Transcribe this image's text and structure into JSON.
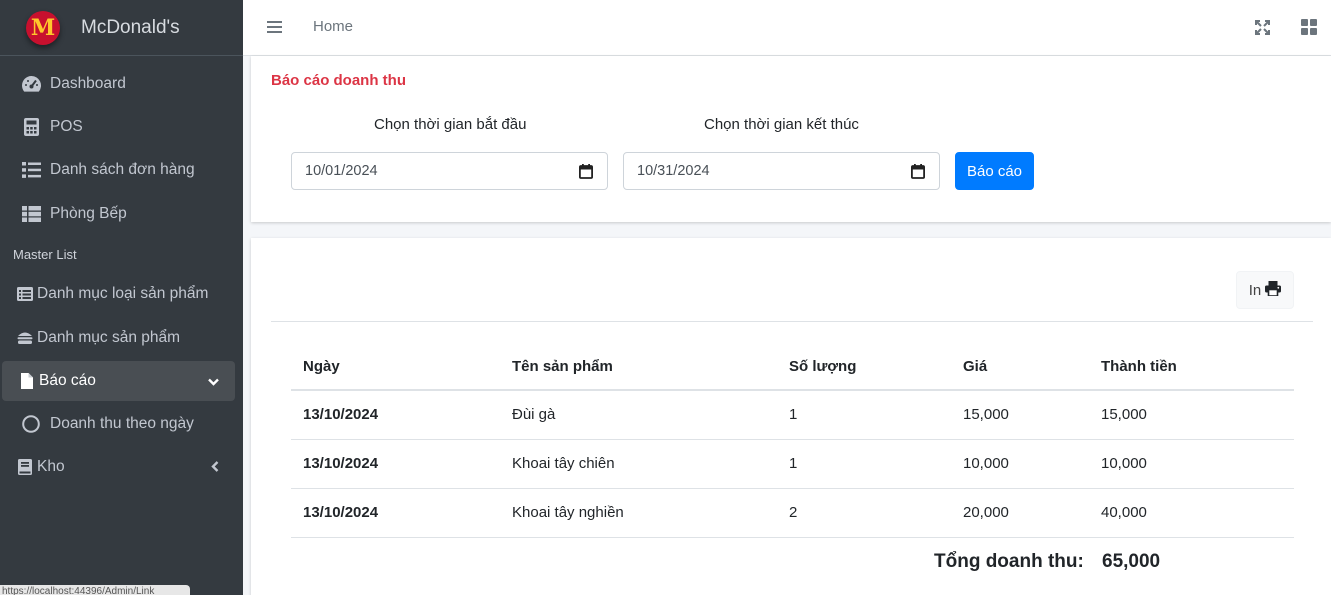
{
  "brand": {
    "logo_letter": "M",
    "name": "McDonald's"
  },
  "sidebar": {
    "items": [
      {
        "label": "Dashboard",
        "icon": "tachometer-icon"
      },
      {
        "label": "POS",
        "icon": "calculator-icon"
      },
      {
        "label": "Danh sách đơn hàng",
        "icon": "list-icon"
      },
      {
        "label": "Phòng Bếp",
        "icon": "table-icon"
      }
    ],
    "header": "Master List",
    "master_items": [
      {
        "label": "Danh mục loại sản phẩm",
        "icon": "list-alt-icon"
      },
      {
        "label": "Danh mục sản phẩm",
        "icon": "hamburger-icon"
      },
      {
        "label": "Báo cáo",
        "icon": "file-icon",
        "expanded": true
      },
      {
        "label": "Doanh thu theo ngày",
        "icon": "circle-icon"
      },
      {
        "label": "Kho",
        "icon": "book-icon",
        "expanded": false
      }
    ],
    "status_url": "https://localhost:44396/Admin/Link"
  },
  "topbar": {
    "home_label": "Home"
  },
  "report_form": {
    "title": "Báo cáo doanh thu",
    "start_label": "Chọn thời gian bắt đầu",
    "end_label": "Chọn thời gian kết thúc",
    "start_value": "10/01/2024",
    "end_value": "10/31/2024",
    "submit_label": "Báo cáo"
  },
  "report_table": {
    "print_label": "In",
    "columns": [
      "Ngày",
      "Tên sản phẩm",
      "Số lượng",
      "Giá",
      "Thành tiền"
    ],
    "rows": [
      {
        "date": "13/10/2024",
        "product": "Đùi gà",
        "qty": "1",
        "price": "15,000",
        "amount": "15,000"
      },
      {
        "date": "13/10/2024",
        "product": "Khoai tây chiên",
        "qty": "1",
        "price": "10,000",
        "amount": "10,000"
      },
      {
        "date": "13/10/2024",
        "product": "Khoai tây nghiền",
        "qty": "2",
        "price": "20,000",
        "amount": "40,000"
      }
    ],
    "total_label": "Tổng doanh thu:",
    "total_value": "65,000"
  },
  "colors": {
    "sidebar_bg": "#343a40",
    "accent": "#007bff",
    "title_red": "#dc3545",
    "logo_red": "#c8102e",
    "logo_yellow": "#ffc72c"
  }
}
